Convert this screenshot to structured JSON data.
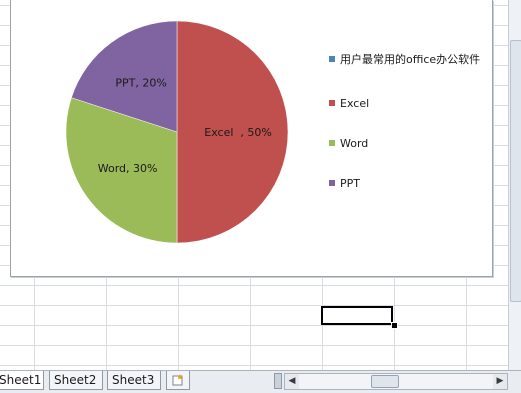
{
  "chart_data": {
    "type": "pie",
    "title": "",
    "categories": [
      "Excel",
      "Word",
      "PPT"
    ],
    "values": [
      50,
      30,
      20
    ],
    "data_labels": [
      "Excel  , 50%",
      "Word, 30%",
      "PPT, 20%"
    ],
    "colors": [
      "#c0504d",
      "#9bbb59",
      "#8064a2"
    ],
    "legend_position": "right",
    "legend": [
      {
        "label": "用户最常用的office办公软件",
        "color": "#4f81bd"
      },
      {
        "label": "Excel",
        "color": "#c0504d"
      },
      {
        "label": "Word",
        "color": "#9bbb59"
      },
      {
        "label": "PPT",
        "color": "#8064a2"
      }
    ]
  },
  "sheet_tabs": {
    "tabs": [
      "Sheet1",
      "Sheet2",
      "Sheet3"
    ],
    "active": "Sheet1",
    "new_sheet_icon": "insert-sheet-icon"
  },
  "scrollbar": {
    "left_arrow": "◀",
    "right_arrow": "▶"
  }
}
